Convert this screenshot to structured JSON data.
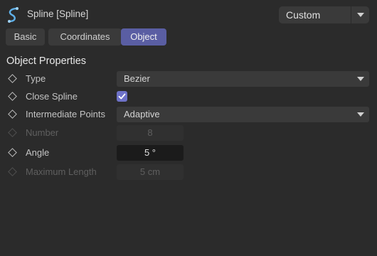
{
  "header": {
    "object_title": "Spline [Spline]",
    "object_icon": "spline-icon",
    "mode_value": "Custom"
  },
  "tabs": [
    {
      "label": "Basic",
      "active": false
    },
    {
      "label": "Coordinates",
      "active": false
    },
    {
      "label": "Object",
      "active": true
    }
  ],
  "section_title": "Object Properties",
  "properties": {
    "type": {
      "label": "Type",
      "value": "Bezier"
    },
    "close_spline": {
      "label": "Close Spline",
      "checked": true
    },
    "intermediate_points": {
      "label": "Intermediate Points",
      "value": "Adaptive"
    },
    "number": {
      "label": "Number",
      "value": "8",
      "enabled": false
    },
    "angle": {
      "label": "Angle",
      "value": "5 °",
      "enabled": true
    },
    "maximum_length": {
      "label": "Maximum Length",
      "value": "5 cm",
      "enabled": false
    }
  },
  "colors": {
    "background": "#2b2b2b",
    "active_tab": "#5a5ea3",
    "checkbox": "#6e72c8",
    "spline_icon": "#5fb0e8"
  }
}
